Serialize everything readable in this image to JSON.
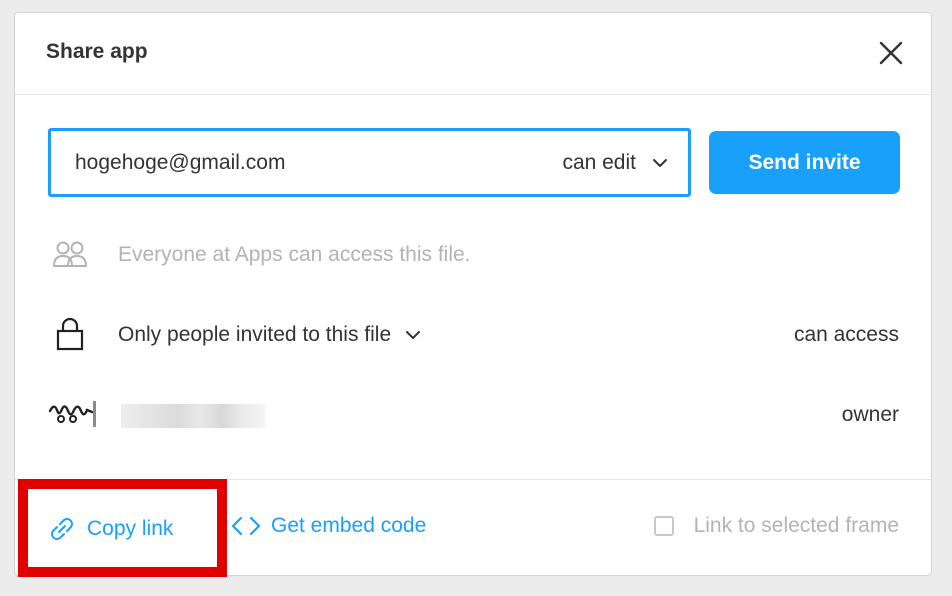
{
  "dialog": {
    "title": "Share app",
    "close_icon": "close-icon"
  },
  "invite": {
    "email_value": "hogehoge@gmail.com",
    "permission": "can edit",
    "send_label": "Send invite"
  },
  "rows": {
    "team": {
      "icon": "people-icon",
      "text": "Everyone at Apps can access this file."
    },
    "link_access": {
      "icon": "lock-icon",
      "text": "Only people invited to this file",
      "right": "can access"
    },
    "member": {
      "icon": "avatar",
      "role": "owner"
    }
  },
  "footer": {
    "copy_link": "Copy link",
    "embed": "Get embed code",
    "frame": "Link to selected frame"
  },
  "colors": {
    "accent": "#18a0fb",
    "highlight": "#e00000",
    "muted": "#b3b3b3",
    "text": "#333333"
  }
}
